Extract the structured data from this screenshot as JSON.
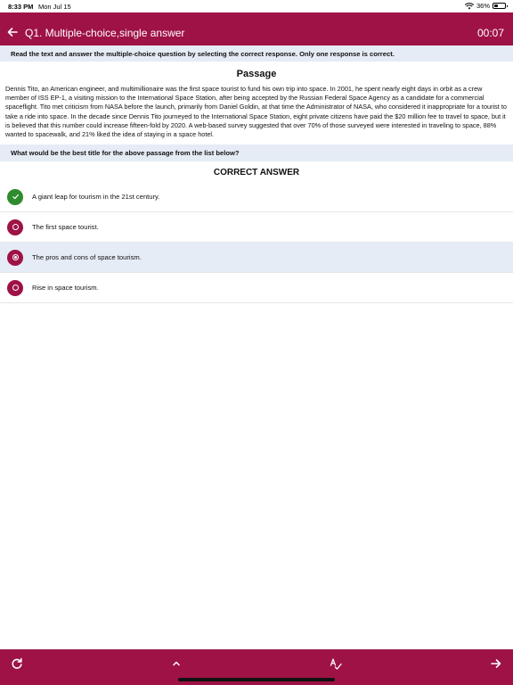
{
  "status_bar": {
    "time": "8:33 PM",
    "date": "Mon Jul 15",
    "battery": "36%",
    "battery_level": 0.36,
    "icons": [
      "wifi-icon",
      "battery-icon"
    ]
  },
  "header": {
    "title": "Q1. Multiple-choice,single answer",
    "timer": "00:07",
    "back_icon": "arrow-left-icon",
    "background": "#9e1246"
  },
  "instruction": "Read the text and answer the multiple-choice question by selecting the correct response. Only one response is correct.",
  "passage": {
    "title": "Passage",
    "text": "Dennis Tito, an American engineer, and multimillionaire was the first space tourist to fund his own trip into space. In 2001, he spent nearly eight days in orbit as a crew member of ISS EP-1, a visiting mission to the International Space Station, after being accepted by the Russian Federal Space Agency as a candidate for a commercial spaceflight. Tito met criticism from NASA before the launch, primarily from Daniel Goldin, at that time the Administrator of NASA, who considered it inappropriate for a tourist to take a ride into space. In the decade since Dennis Tito journeyed to the International Space Station, eight private citizens have paid the $20 million fee to travel to space, but it is believed that this number could increase fifteen-fold by 2020. A web-based survey suggested that over 70% of those surveyed were interested in traveling to space, 88% wanted to spacewalk, and 21% liked the idea of staying in a space hotel."
  },
  "question": "What would be the best title for the above passage from the list below?",
  "correct_answer_title": "CORRECT ANSWER",
  "options": [
    {
      "label": "A giant leap for tourism in the 21st century.",
      "state": "correct",
      "icon": "check-icon"
    },
    {
      "label": "The first space tourist.",
      "state": "unselected",
      "icon": "radio-icon"
    },
    {
      "label": "The pros and cons of space tourism.",
      "state": "selected",
      "icon": "radio-checked-icon"
    },
    {
      "label": "Rise in space tourism.",
      "state": "unselected",
      "icon": "radio-icon"
    }
  ],
  "bottom_bar": {
    "icons": [
      "refresh-icon",
      "chevron-up-icon",
      "spellcheck-icon",
      "arrow-right-icon"
    ]
  },
  "colors": {
    "accent": "#9e1246",
    "correct": "#2e8b2e",
    "highlight": "#e6ecf6"
  }
}
